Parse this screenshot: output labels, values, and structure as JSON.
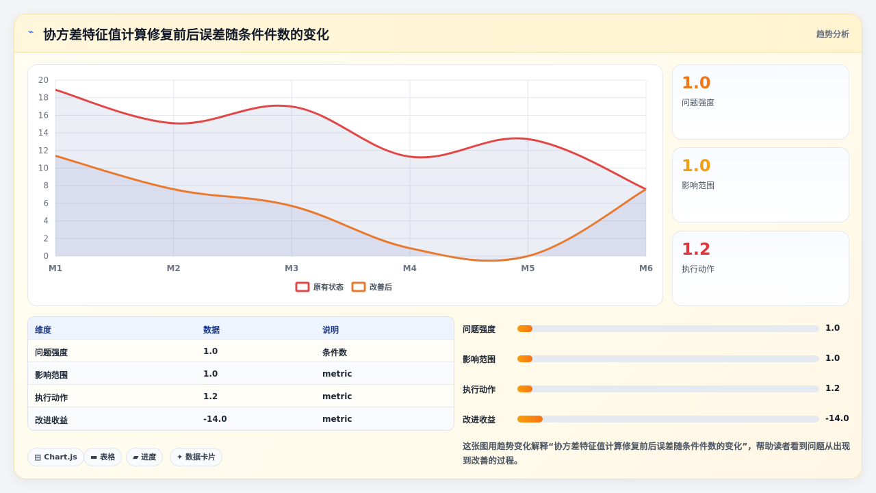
{
  "header": {
    "icon": "trend-icon",
    "title": "协方差特征值计算修复前后误差随条件件数的变化",
    "tag": "趋势分析"
  },
  "chart_data": {
    "type": "line",
    "categories": [
      "M1",
      "M2",
      "M3",
      "M4",
      "M5",
      "M6"
    ],
    "yticks": [
      "0",
      "2",
      "4",
      "6",
      "8",
      "10",
      "12",
      "14",
      "16",
      "18",
      "20"
    ],
    "ylim": [
      0,
      20
    ],
    "series": [
      {
        "name": "原有状态",
        "values": [
          18.9,
          15.1,
          17.0,
          11.3,
          13.3,
          7.6
        ],
        "color": "#e04848"
      },
      {
        "name": "改善后",
        "values": [
          11.4,
          7.6,
          5.7,
          0.9,
          0.0,
          7.6
        ],
        "color": "#e87a30"
      }
    ],
    "area_fill": true,
    "grid": true,
    "legend": "bottom"
  },
  "stats": [
    {
      "value": "1.0",
      "label": "问题强度",
      "color": "#f07818"
    },
    {
      "value": "1.0",
      "label": "影响范围",
      "color": "#f0a010"
    },
    {
      "value": "1.2",
      "label": "执行动作",
      "color": "#e0343c"
    }
  ],
  "table": {
    "headers": [
      "维度",
      "数据",
      "说明"
    ],
    "rows": [
      [
        "问题强度",
        "1.0",
        "条件数"
      ],
      [
        "影响范围",
        "1.0",
        "metric"
      ],
      [
        "执行动作",
        "1.2",
        "metric"
      ],
      [
        "改进收益",
        "-14.0",
        "metric"
      ]
    ]
  },
  "progress": [
    {
      "label": "问题强度",
      "value": "1.0",
      "fraction": 0.05
    },
    {
      "label": "影响范围",
      "value": "1.0",
      "fraction": 0.05
    },
    {
      "label": "执行动作",
      "value": "1.2",
      "fraction": 0.05
    },
    {
      "label": "改进收益",
      "value": "-14.0",
      "fraction": 0.085
    }
  ],
  "chips": [
    "Chart.js",
    "表格",
    "进度",
    "数据卡片"
  ],
  "chip_icons": [
    "chart-icon",
    "table-icon",
    "progress-icon",
    "card-icon"
  ],
  "description": "这张图用趋势变化解释“协方差特征值计算修复前后误差随条件件数的变化”，帮助读者看到问题从出现到改善的过程。"
}
